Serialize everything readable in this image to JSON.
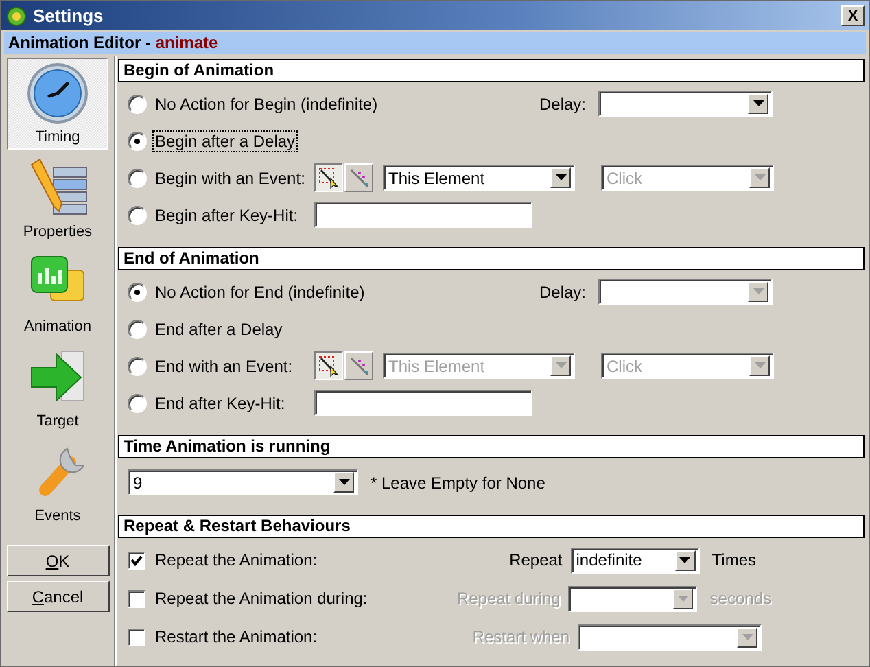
{
  "window": {
    "title": "Settings",
    "close": "X"
  },
  "header": {
    "title": "Animation Editor - ",
    "object": "animate"
  },
  "sidebar": {
    "items": [
      {
        "label": "Timing",
        "selected": true
      },
      {
        "label": "Properties",
        "selected": false
      },
      {
        "label": "Animation",
        "selected": false
      },
      {
        "label": "Target",
        "selected": false
      },
      {
        "label": "Events",
        "selected": false
      }
    ],
    "buttons": [
      {
        "label": "OK"
      },
      {
        "label": "Cancel"
      }
    ]
  },
  "sections": [
    {
      "title": "Begin of Animation",
      "rows": [
        {
          "kind": "radio",
          "label": "No Action for Begin (indefinite)",
          "selected": false,
          "focused": false,
          "controls": [
            {
              "kind": "caption",
              "text": "Delay:",
              "disabled": false
            },
            {
              "kind": "combo",
              "disabled": false
            }
          ]
        },
        {
          "kind": "radio",
          "label": "Begin after a Delay",
          "selected": true,
          "focused": true,
          "controls": []
        },
        {
          "kind": "radio",
          "label": "Begin with an Event:",
          "selected": false,
          "focused": false,
          "controls": [
            {
              "kind": "picker",
              "buttons": [
                {
                  "selected": true
                },
                {
                  "selected": false
                }
              ]
            },
            {
              "kind": "combo",
              "value": "This Element",
              "disabled": false
            },
            {
              "kind": "combo",
              "value": "Click",
              "disabled": true
            }
          ]
        },
        {
          "kind": "radio",
          "label": "Begin after Key-Hit:",
          "selected": false,
          "focused": false,
          "controls": [
            {
              "kind": "text"
            }
          ]
        }
      ]
    },
    {
      "title": "End of Animation",
      "rows": [
        {
          "kind": "radio",
          "label": "No Action for End (indefinite)",
          "selected": true,
          "focused": false,
          "controls": [
            {
              "kind": "caption",
              "text": "Delay:",
              "disabled": false
            },
            {
              "kind": "combo",
              "disabled": true
            }
          ]
        },
        {
          "kind": "radio",
          "label": "End after a Delay",
          "selected": false,
          "focused": false,
          "controls": []
        },
        {
          "kind": "radio",
          "label": "End with an Event:",
          "selected": false,
          "focused": false,
          "controls": [
            {
              "kind": "picker",
              "buttons": [
                {
                  "selected": true
                },
                {
                  "selected": false
                }
              ]
            },
            {
              "kind": "combo",
              "value": "This Element",
              "disabled": true
            },
            {
              "kind": "combo",
              "value": "Click",
              "disabled": true
            }
          ]
        },
        {
          "kind": "radio",
          "label": "End after Key-Hit:",
          "selected": false,
          "focused": false,
          "controls": [
            {
              "kind": "text"
            }
          ]
        }
      ]
    },
    {
      "title": "Time Animation is running",
      "rows": [
        {
          "kind": "plain",
          "controls": [
            {
              "kind": "combo",
              "value": "9",
              "disabled": false
            },
            {
              "kind": "note",
              "text": "* Leave Empty for None",
              "disabled": false
            }
          ]
        }
      ]
    },
    {
      "title": "Repeat & Restart Behaviours",
      "rows": [
        {
          "kind": "checkbox",
          "label": "Repeat the Animation:",
          "checked": true,
          "focused": false,
          "controls": [
            {
              "kind": "caption",
              "text": "Repeat",
              "disabled": false
            },
            {
              "kind": "combo",
              "value": "indefinite",
              "disabled": false
            },
            {
              "kind": "note",
              "text": "Times",
              "disabled": false
            }
          ]
        },
        {
          "kind": "checkbox",
          "label": "Repeat the Animation during:",
          "checked": false,
          "focused": false,
          "controls": [
            {
              "kind": "caption",
              "text": "Repeat during",
              "disabled": true
            },
            {
              "kind": "combo",
              "disabled": true
            },
            {
              "kind": "note",
              "text": "seconds",
              "disabled": true
            }
          ]
        },
        {
          "kind": "checkbox",
          "label": "Restart the Animation:",
          "checked": false,
          "focused": false,
          "controls": [
            {
              "kind": "caption",
              "text": "Restart when",
              "disabled": true
            },
            {
              "kind": "combo",
              "disabled": true
            }
          ]
        }
      ]
    }
  ]
}
